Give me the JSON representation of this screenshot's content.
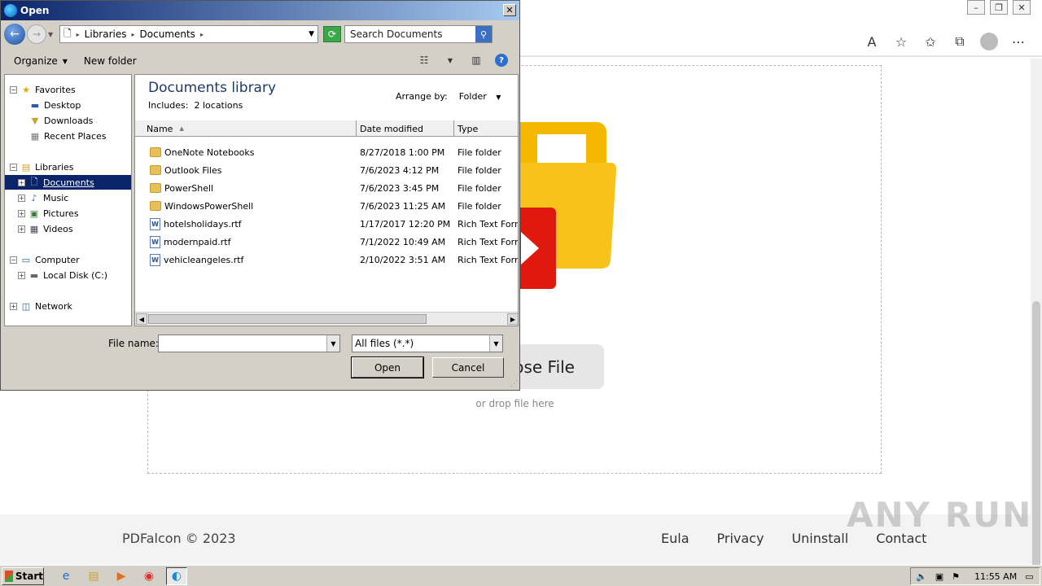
{
  "browser": {
    "page": {
      "choose_label": "ose File",
      "drop_text": "or drop file here"
    },
    "footer": {
      "copyright": "PDFalcon © 2023",
      "links": [
        "Eula",
        "Privacy",
        "Uninstall",
        "Contact"
      ]
    },
    "watermark": "ANY RUN"
  },
  "dialog": {
    "title": "Open",
    "breadcrumb": [
      "Libraries",
      "Documents"
    ],
    "search_placeholder": "Search Documents",
    "toolbar": {
      "organize": "Organize",
      "new_folder": "New folder"
    },
    "tree": {
      "favorites": "Favorites",
      "desktop": "Desktop",
      "downloads": "Downloads",
      "recent": "Recent Places",
      "libraries": "Libraries",
      "documents": "Documents",
      "music": "Music",
      "pictures": "Pictures",
      "videos": "Videos",
      "computer": "Computer",
      "local_disk": "Local Disk (C:)",
      "network": "Network"
    },
    "library": {
      "title": "Documents library",
      "includes_label": "Includes:",
      "locations": "2 locations",
      "arrange_by_label": "Arrange by:",
      "arrange_by_value": "Folder"
    },
    "columns": {
      "name": "Name",
      "date": "Date modified",
      "type": "Type"
    },
    "files": [
      {
        "name": "OneNote Notebooks",
        "date": "8/27/2018 1:00 PM",
        "type": "File folder",
        "kind": "folder"
      },
      {
        "name": "Outlook Files",
        "date": "7/6/2023 4:12 PM",
        "type": "File folder",
        "kind": "folder"
      },
      {
        "name": "PowerShell",
        "date": "7/6/2023 3:45 PM",
        "type": "File folder",
        "kind": "folder"
      },
      {
        "name": "WindowsPowerShell",
        "date": "7/6/2023 11:25 AM",
        "type": "File folder",
        "kind": "folder"
      },
      {
        "name": "hotelsholidays.rtf",
        "date": "1/17/2017 12:20 PM",
        "type": "Rich Text Forma",
        "kind": "doc"
      },
      {
        "name": "modernpaid.rtf",
        "date": "7/1/2022 10:49 AM",
        "type": "Rich Text Forma",
        "kind": "doc"
      },
      {
        "name": "vehicleangeles.rtf",
        "date": "2/10/2022 3:51 AM",
        "type": "Rich Text Forma",
        "kind": "doc"
      }
    ],
    "file_name_label": "File name:",
    "file_name_value": "",
    "file_type": "All files (*.*)",
    "open_label": "Open",
    "cancel_label": "Cancel"
  },
  "taskbar": {
    "start_label": "Start",
    "clock": "11:55 AM"
  }
}
